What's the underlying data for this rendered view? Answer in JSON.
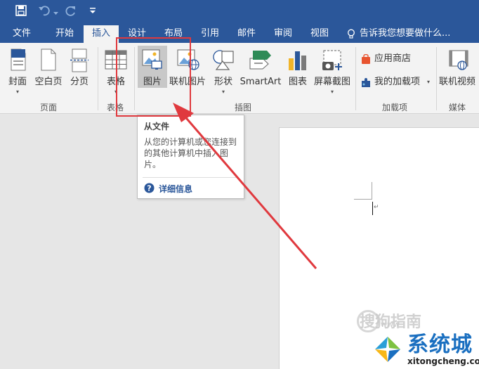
{
  "tabs": [
    {
      "label": "文件"
    },
    {
      "label": "开始"
    },
    {
      "label": "插入"
    },
    {
      "label": "设计"
    },
    {
      "label": "布局"
    },
    {
      "label": "引用"
    },
    {
      "label": "邮件"
    },
    {
      "label": "审阅"
    },
    {
      "label": "视图"
    }
  ],
  "tell_me": "告诉我您想要做什么...",
  "ribbon": {
    "cover": "封面",
    "blank_page": "空白页",
    "page_break": "分页",
    "table": "表格",
    "picture": "图片",
    "online_picture": "联机图片",
    "shapes": "形状",
    "smartart": "SmartArt",
    "chart": "图表",
    "screenshot": "屏幕截图",
    "app_store": "应用商店",
    "my_addins": "我的加载项",
    "online_video": "联机视频",
    "dropdown_glyph": "▾",
    "groups": {
      "pages": "页面",
      "tables": "表格",
      "illustrations": "插图",
      "addins": "加载项",
      "media": "媒体"
    }
  },
  "tooltip": {
    "title": "从文件",
    "body": "从您的计算机或您连接到的其他计算机中插入图片。",
    "help_label": "详细信息"
  },
  "document": {
    "paragraph_mark": "↵"
  },
  "watermark": {
    "text": "搜狗指南",
    "sub": "www",
    "brand": "系统城",
    "url": "xitongcheng.com"
  },
  "colors": {
    "titlebar": "#2b579a",
    "highlight": "#e0393e",
    "brand": "#1a6fc0"
  }
}
